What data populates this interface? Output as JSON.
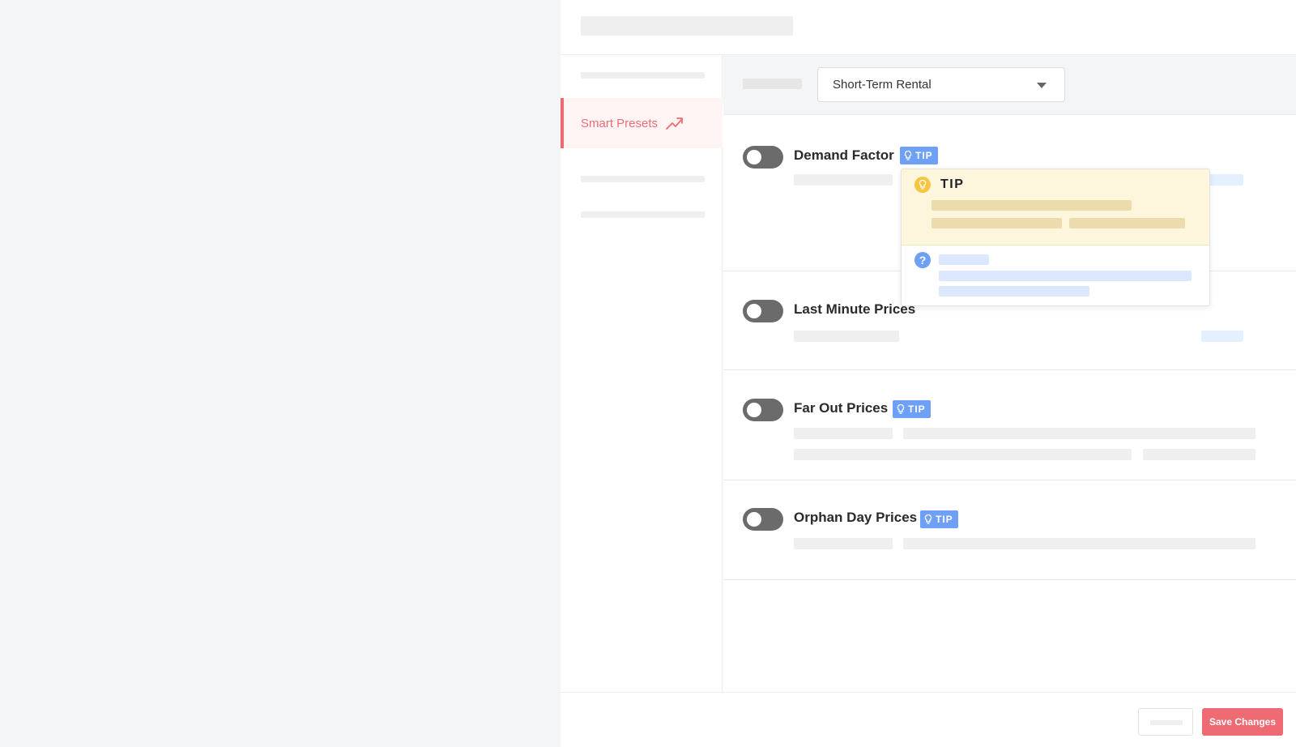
{
  "sidebar": {
    "active_item": {
      "label": "Smart Presets",
      "icon": "trending-up-icon"
    }
  },
  "filter": {
    "selected": "Short-Term Rental",
    "icon": "chevron-down-icon"
  },
  "rules": [
    {
      "title": "Demand Factor",
      "enabled": false,
      "tip": "TIP"
    },
    {
      "title": "Last Minute Prices",
      "enabled": false
    },
    {
      "title": "Far Out Prices",
      "enabled": false,
      "tip": "TIP"
    },
    {
      "title": "Orphan Day Prices",
      "enabled": false,
      "tip": "TIP"
    }
  ],
  "popover": {
    "title": "TIP",
    "title_icon": "lightbulb-icon",
    "help_icon": "question-icon",
    "help_glyph": "?"
  },
  "footer": {
    "save_label": "Save Changes"
  },
  "colors": {
    "accent": "#ef6b73",
    "tip_blue": "#6ea0f5",
    "toggle_off": "#6b6b6b",
    "tip_bg": "#fdf6dd"
  }
}
